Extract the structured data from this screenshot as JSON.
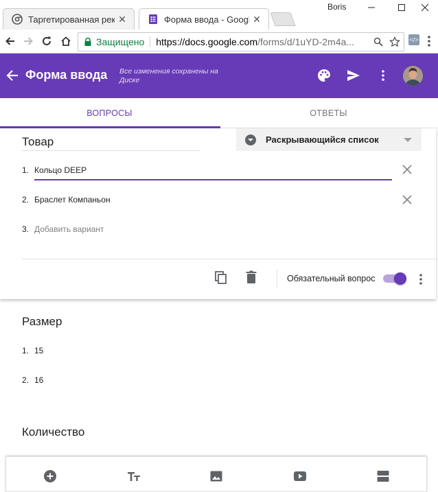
{
  "browser": {
    "tabs": [
      {
        "title": "Таргетированная рекла",
        "icon": "chrome-icon",
        "active": false
      },
      {
        "title": "Форма ввода - Google Ф",
        "icon": "google-forms-icon",
        "active": true
      }
    ],
    "user": "Boris",
    "address": {
      "secure_label": "Защищено",
      "url_host": "https://docs.google.com",
      "url_rest": "/forms/d/1uYD-2m4a..."
    }
  },
  "forms": {
    "title": "Форма ввода",
    "saved_status": "Все изменения сохранены на Диске",
    "accent_color": "#673ab7",
    "tabs": [
      {
        "label": "ВОПРОСЫ",
        "active": true
      },
      {
        "label": "ОТВЕТЫ",
        "active": false
      }
    ]
  },
  "active_question": {
    "title": "Товар",
    "type_label": "Раскрывающийся список",
    "options": [
      {
        "num": "1.",
        "text": "Кольцо DEEP"
      },
      {
        "num": "2.",
        "text": "Браслет Компаньон"
      }
    ],
    "add_option": {
      "num": "3.",
      "text": "Добавить вариант"
    },
    "required_label": "Обязательный вопрос",
    "required": true
  },
  "question_size": {
    "title": "Размер",
    "options": [
      {
        "num": "1.",
        "text": "15"
      },
      {
        "num": "2.",
        "text": "16"
      }
    ]
  },
  "question_qty": {
    "title": "Количество"
  }
}
